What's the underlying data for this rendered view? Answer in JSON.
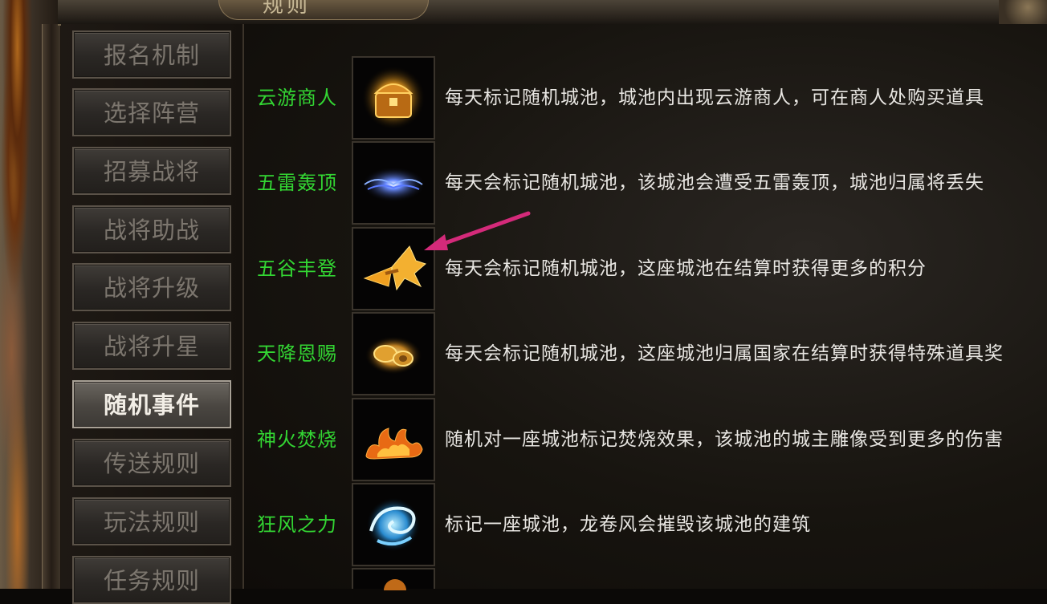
{
  "window": {
    "title_fragment": "规则"
  },
  "menu": {
    "items": [
      {
        "label": "报名机制"
      },
      {
        "label": "选择阵营"
      },
      {
        "label": "招募战将"
      },
      {
        "label": "战将助战"
      },
      {
        "label": "战将升级"
      },
      {
        "label": "战将升星"
      },
      {
        "label": "随机事件",
        "active": true
      },
      {
        "label": "传送规则"
      },
      {
        "label": "玩法规则"
      },
      {
        "label": "任务规则"
      }
    ]
  },
  "events": [
    {
      "name": "云游商人",
      "icon": "treasure-chest-icon",
      "desc": "每天标记随机城池，城池内出现云游商人，可在商人处购买道具"
    },
    {
      "name": "五雷轰顶",
      "icon": "lightning-icon",
      "desc": "每天会标记随机城池，该城池会遭受五雷轰顶，城池归属将丢失"
    },
    {
      "name": "五谷丰登",
      "icon": "grain-sheaf-icon",
      "desc": "每天会标记随机城池，这座城池在结算时获得更多的积分"
    },
    {
      "name": "天降恩赐",
      "icon": "gold-coins-icon",
      "desc": "每天会标记随机城池，这座城池归属国家在结算时获得特殊道具奖"
    },
    {
      "name": "神火焚烧",
      "icon": "fire-icon",
      "desc": "随机对一座城池标记焚烧效果，该城池的城主雕像受到更多的伤害"
    },
    {
      "name": "狂风之力",
      "icon": "whirlwind-icon",
      "desc": "标记一座城池，龙卷风会摧毁该城池的建筑"
    }
  ],
  "colors": {
    "event_name": "#33d633",
    "description": "#e8e6e2",
    "annotation_arrow": "#d42a7a"
  }
}
